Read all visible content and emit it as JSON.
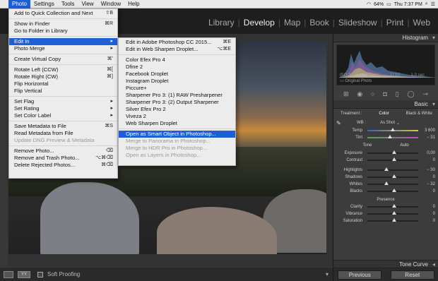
{
  "macbar": {
    "menus": [
      "Photo",
      "Settings",
      "Tools",
      "View",
      "Window",
      "Help"
    ],
    "active": "Photo",
    "battery": "64%",
    "clock": "Thu 7:37 PM"
  },
  "modules": [
    "Library",
    "Develop",
    "Map",
    "Book",
    "Slideshow",
    "Print",
    "Web"
  ],
  "active_module": "Develop",
  "photo_menu": {
    "groups": [
      [
        {
          "label": "Add to Quick Collection and Next",
          "shortcut": "⇧B"
        }
      ],
      [
        {
          "label": "Show in Finder",
          "shortcut": "⌘R"
        },
        {
          "label": "Go to Folder in Library",
          "shortcut": ""
        }
      ],
      [
        {
          "label": "Edit In",
          "shortcut": "▸"
        },
        {
          "label": "Photo Merge",
          "shortcut": "▸"
        }
      ],
      [
        {
          "label": "Create Virtual Copy",
          "shortcut": "⌘'"
        }
      ],
      [
        {
          "label": "Rotate Left (CCW)",
          "shortcut": "⌘["
        },
        {
          "label": "Rotate Right (CW)",
          "shortcut": "⌘]"
        },
        {
          "label": "Flip Horizontal",
          "shortcut": ""
        },
        {
          "label": "Flip Vertical",
          "shortcut": ""
        }
      ],
      [
        {
          "label": "Set Flag",
          "shortcut": "▸"
        },
        {
          "label": "Set Rating",
          "shortcut": "▸"
        },
        {
          "label": "Set Color Label",
          "shortcut": "▸"
        }
      ],
      [
        {
          "label": "Save Metadata to File",
          "shortcut": "⌘S"
        },
        {
          "label": "Read Metadata from File",
          "shortcut": ""
        },
        {
          "label": "Update DNG Preview & Metadata",
          "shortcut": ""
        }
      ],
      [
        {
          "label": "Remove Photo...",
          "shortcut": "⌫"
        },
        {
          "label": "Remove and Trash Photo...",
          "shortcut": "⌥⌘⌫"
        },
        {
          "label": "Delete Rejected Photos...",
          "shortcut": "⌘⌫"
        }
      ]
    ]
  },
  "edit_in_submenu": {
    "items": [
      {
        "label": "Edit in Adobe Photoshop CC 2015...",
        "shortcut": "⌘E"
      },
      {
        "label": "Edit in Web Sharpen Droplet...",
        "shortcut": "⌥⌘E"
      },
      {
        "label": "Color Efex Pro 4",
        "shortcut": ""
      },
      {
        "label": "Dfine 2",
        "shortcut": ""
      },
      {
        "label": "Facebook Droplet",
        "shortcut": ""
      },
      {
        "label": "Instagram Droplet",
        "shortcut": ""
      },
      {
        "label": "Piccure+",
        "shortcut": ""
      },
      {
        "label": "Sharpener Pro 3: (1) RAW Presharpener",
        "shortcut": ""
      },
      {
        "label": "Sharpener Pro 3: (2) Output Sharpener",
        "shortcut": ""
      },
      {
        "label": "Silver Efex Pro 2",
        "shortcut": ""
      },
      {
        "label": "Viveza 2",
        "shortcut": ""
      },
      {
        "label": "Web Sharpen Droplet",
        "shortcut": ""
      },
      {
        "label": "Open as Smart Object in Photoshop...",
        "shortcut": ""
      },
      {
        "label": "Merge to Panorama in Photoshop...",
        "shortcut": ""
      },
      {
        "label": "Merge to HDR Pro in Photoshop...",
        "shortcut": ""
      },
      {
        "label": "Open as Layers in Photoshop...",
        "shortcut": ""
      }
    ]
  },
  "histogram": {
    "title": "Histogram",
    "iso": "ISO 200",
    "focal": "16 mm",
    "aperture": "f / 22",
    "shutter": "1,0 sec",
    "original": "Original Photo"
  },
  "basic": {
    "title": "Basic",
    "treatment_label": "Treatment :",
    "color": "Color",
    "bw": "Black & White",
    "wb_label": "WB :",
    "wb_value": "As Shot",
    "temp_label": "Temp",
    "temp_value": "3 600",
    "tint_label": "Tint",
    "tint_value": "− 31",
    "tone_label": "Tone",
    "auto": "Auto",
    "exposure_label": "Exposure",
    "exposure_value": "0,00",
    "contrast_label": "Contrast",
    "contrast_value": "0",
    "highlights_label": "Highlights",
    "highlights_value": "− 30",
    "shadows_label": "Shadows",
    "shadows_value": "0",
    "whites_label": "Whites",
    "whites_value": "− 32",
    "blacks_label": "Blacks",
    "blacks_value": "0",
    "presence_label": "Presence",
    "clarity_label": "Clarity",
    "clarity_value": "0",
    "vibrance_label": "Vibrance",
    "vibrance_value": "0",
    "saturation_label": "Saturation",
    "saturation_value": "0"
  },
  "tone_curve": "Tone Curve",
  "previous": "Previous",
  "reset": "Reset",
  "soft_proofing": "Soft Proofing"
}
